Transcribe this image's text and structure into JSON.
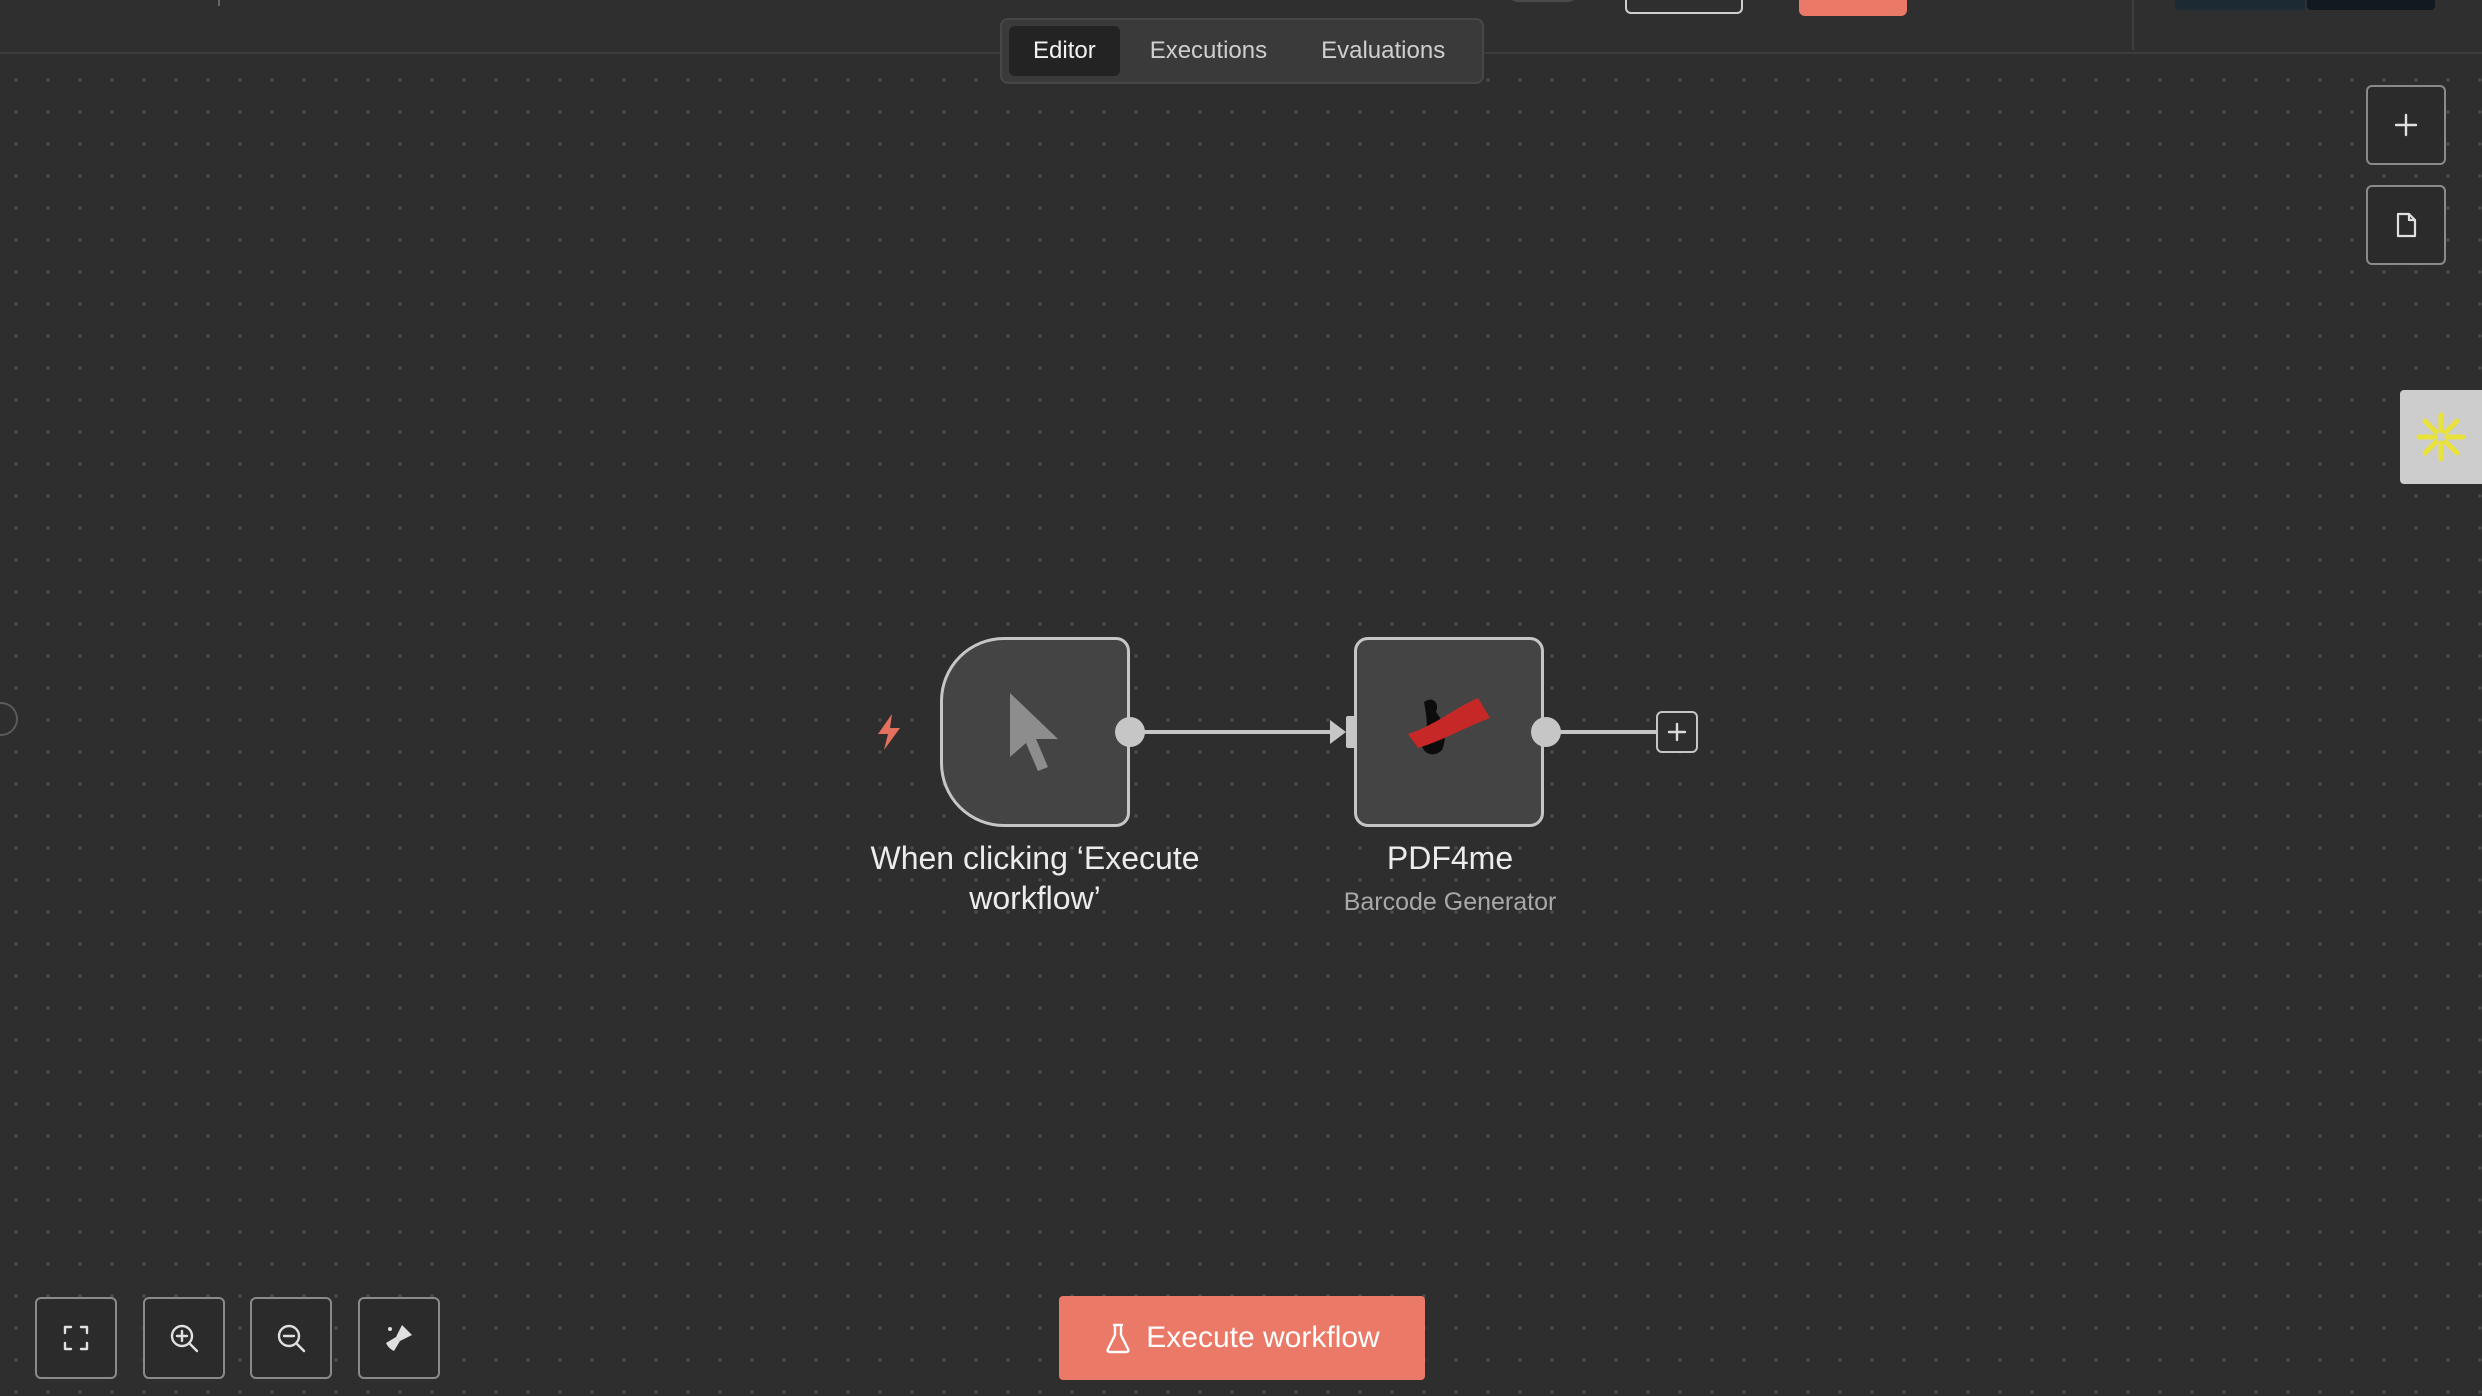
{
  "tabs": [
    {
      "label": "Editor",
      "active": true
    },
    {
      "label": "Executions",
      "active": false
    },
    {
      "label": "Evaluations",
      "active": false
    }
  ],
  "nodes": {
    "trigger": {
      "label": "When clicking ‘Execute workflow’",
      "icon": "cursor-pointer-icon"
    },
    "pdf": {
      "label": "PDF4me",
      "subtitle": "Barcode Generator",
      "icon": "pdf4me-logo-icon"
    }
  },
  "execute_button": {
    "label": "Execute workflow",
    "icon": "flask-icon"
  },
  "side_buttons": [
    {
      "icon": "plus-icon"
    },
    {
      "icon": "sticky-note-icon"
    }
  ],
  "zoom_controls": [
    {
      "icon": "fit-view-icon"
    },
    {
      "icon": "zoom-in-icon"
    },
    {
      "icon": "zoom-out-icon"
    },
    {
      "icon": "tidy-up-icon"
    }
  ],
  "colors": {
    "accent": "#ea7967",
    "canvas": "#2e2e2e",
    "node_border": "#c6c6c6",
    "ai_spark": "#e8e23a"
  }
}
